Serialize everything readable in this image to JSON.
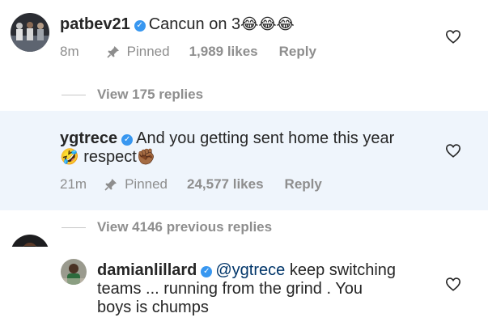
{
  "comments": [
    {
      "username": "patbev21",
      "text": "Cancun on 3",
      "emoji": "😂😂😂",
      "time": "8m",
      "pinned": "Pinned",
      "likes": "1,989 likes",
      "reply": "Reply"
    },
    {
      "username": "ygtrece",
      "text": "And you getting sent home this year",
      "emoji_start": "🤣",
      "text2": "respect",
      "emoji_end": "✊🏾",
      "time": "21m",
      "pinned": "Pinned",
      "likes": "24,577 likes",
      "reply": "Reply"
    },
    {
      "username": "damianlillard",
      "mention": "@ygtrece",
      "text_line1": "keep switching",
      "text_line2": "teams ... running from the grind . You",
      "text_line3": "boys is chumps"
    }
  ],
  "view_replies_1": "View 175 replies",
  "view_replies_2": "View 4146 previous replies",
  "colors": {
    "highlight_bg": "#eff5fc",
    "meta_gray": "#8e8e8e",
    "verified_blue": "#3897f0",
    "mention_blue": "#003569"
  },
  "icons": [
    "verified-badge-icon",
    "pin-icon",
    "heart-icon"
  ]
}
